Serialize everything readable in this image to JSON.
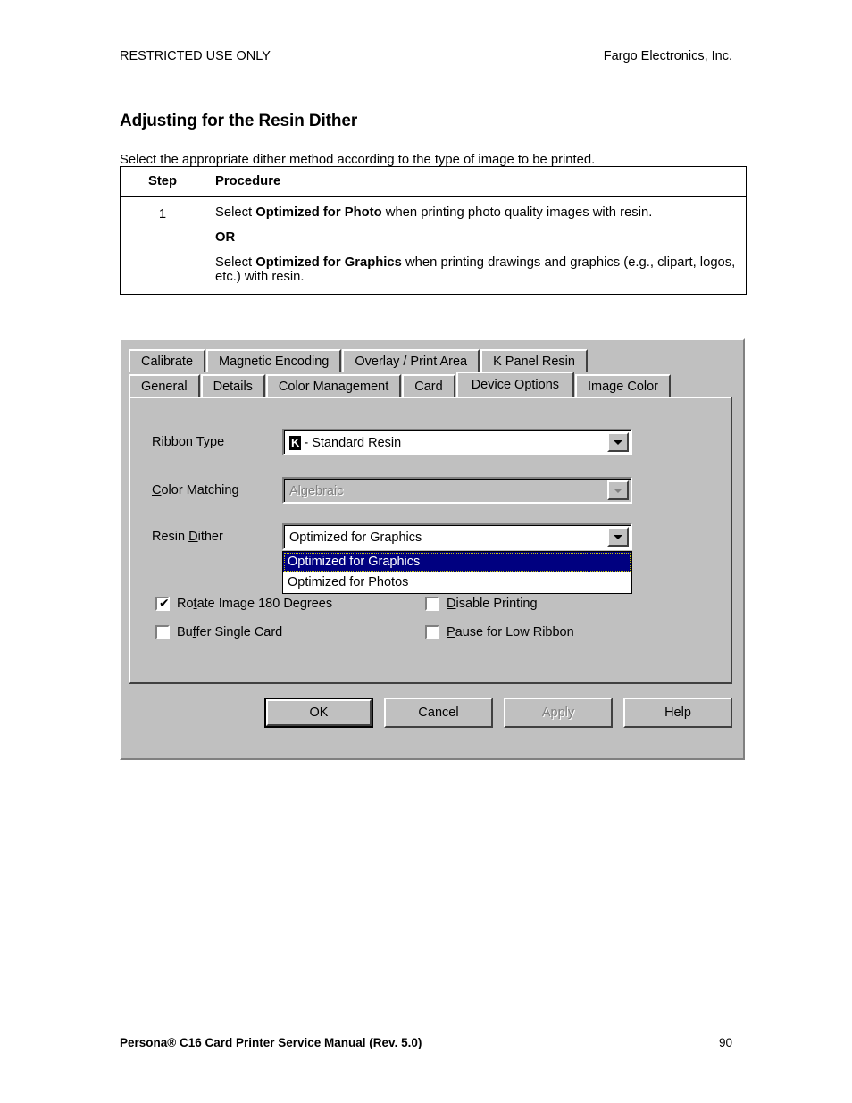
{
  "header": {
    "left": "RESTRICTED USE ONLY",
    "right": "Fargo Electronics, Inc."
  },
  "section": {
    "title": "Adjusting for the Resin Dither",
    "intro": "Select the appropriate dither method according to the type of image to be printed."
  },
  "table": {
    "headers": [
      "Step",
      "Procedure"
    ],
    "rows": [
      {
        "step": "1",
        "lines": [
          {
            "prefix": "Select ",
            "bold": "Optimized for Photo",
            "suffix": " when printing photo quality images with resin."
          },
          {
            "prefix": "",
            "bold": "OR",
            "suffix": ""
          },
          {
            "prefix": "Select ",
            "bold": "Optimized for Graphics",
            "suffix": " when printing drawings and graphics (e.g., clipart, logos, etc.) with resin."
          }
        ]
      }
    ]
  },
  "dialog": {
    "tabs_row1": [
      {
        "label": "Calibrate",
        "active": false
      },
      {
        "label": "Magnetic Encoding",
        "active": false
      },
      {
        "label": "Overlay / Print Area",
        "active": false
      },
      {
        "label": "K Panel Resin",
        "active": false
      }
    ],
    "tabs_row2": [
      {
        "label": "General",
        "active": false
      },
      {
        "label": "Details",
        "active": false
      },
      {
        "label": "Color Management",
        "active": false
      },
      {
        "label": "Card",
        "active": false
      },
      {
        "label": "Device Options",
        "active": true
      },
      {
        "label": "Image Color",
        "active": false
      }
    ],
    "fields": {
      "ribbon_type": {
        "label_pre": "",
        "label_accel": "R",
        "label_post": "ibbon Type",
        "chip": "K",
        "value": "- Standard Resin",
        "enabled": true
      },
      "color_matching": {
        "label_pre": "",
        "label_accel": "C",
        "label_post": "olor Matching",
        "value": "Algebraic",
        "enabled": false
      },
      "resin_dither": {
        "label_pre": "Resin ",
        "label_accel": "D",
        "label_post": "ither",
        "value": "Optimized for Graphics",
        "enabled": true,
        "open": true,
        "options": [
          {
            "label": "Optimized for Graphics",
            "selected": true
          },
          {
            "label": "Optimized for Photos",
            "selected": false
          }
        ]
      }
    },
    "checkboxes": [
      {
        "name": "rotate-image-180-degrees",
        "pre": "Ro",
        "accel": "t",
        "post": "ate Image 180 Degrees",
        "checked": true,
        "tick": "✔"
      },
      {
        "name": "buffer-single-card",
        "pre": "Bu",
        "accel": "f",
        "post": "fer Single Card",
        "checked": false,
        "tick": ""
      },
      {
        "name": "disable-printing",
        "pre": "",
        "accel": "D",
        "post": "isable Printing",
        "checked": false,
        "tick": ""
      },
      {
        "name": "pause-for-low-ribbon",
        "pre": "",
        "accel": "P",
        "post": "ause for Low Ribbon",
        "checked": false,
        "tick": ""
      }
    ],
    "buttons": [
      {
        "name": "ok",
        "label": "OK",
        "default": true,
        "disabled": false,
        "accel": ""
      },
      {
        "name": "cancel",
        "label": "Cancel",
        "default": false,
        "disabled": false,
        "accel": ""
      },
      {
        "name": "apply",
        "label": "Apply",
        "default": false,
        "disabled": true,
        "accel": "A"
      },
      {
        "name": "help",
        "label": "Help",
        "default": false,
        "disabled": false,
        "accel": ""
      }
    ]
  },
  "footer": {
    "title": "Persona® C16 Card Printer Service Manual (Rev. 5.0)",
    "page_number": "90"
  },
  "colors": {
    "dialog_face": "#c0c0c0",
    "highlight": "#000080",
    "highlight_text": "#ffffff",
    "disabled_text": "#808080"
  }
}
